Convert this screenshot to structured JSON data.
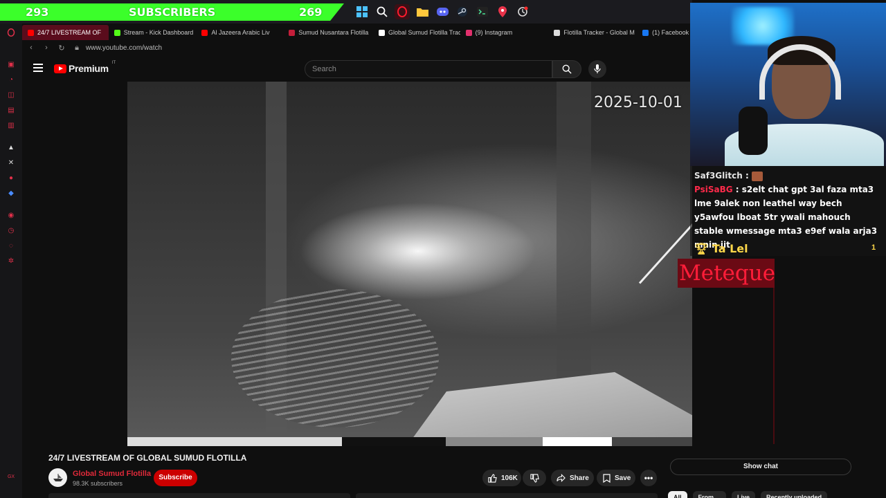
{
  "overlay": {
    "subscriber_count_left": "293",
    "subscribers_label": "SUBSCRIBERS",
    "subscriber_goal": "269",
    "accent": "#3bff2a"
  },
  "taskbar_icons": [
    "windows-icon",
    "search-icon",
    "opera-icon",
    "folder-icon",
    "discord-icon",
    "steam-icon",
    "terminal-icon",
    "maps-pin-icon",
    "updates-icon"
  ],
  "browser": {
    "tabs": [
      {
        "label": "24/7 LIVESTREAM OF",
        "color": "#ff0000"
      },
      {
        "label": "Stream - Kick Dashboard",
        "color": "#53fc18"
      },
      {
        "label": "Al Jazeera Arabic Liv",
        "color": "#ff0000"
      },
      {
        "label": "Sumud Nusantara Flotilla",
        "color": "#c41e3a"
      },
      {
        "label": "Global Sumud Flotilla Trac",
        "color": "#ffffff"
      },
      {
        "label": "(9) Instagram",
        "color": "#e1306c"
      },
      {
        "label": "Flotilla Tracker - Global M",
        "color": "#dddddd"
      },
      {
        "label": "(1) Facebook",
        "color": "#1877f2"
      }
    ],
    "url": "www.youtube.com/watch"
  },
  "youtube": {
    "logo_text": "Premium",
    "logo_region": "IT",
    "search_placeholder": "Search",
    "video_timestamp": "2025-10-01",
    "video_title": "24/7 LIVESTREAM OF GLOBAL SUMUD FLOTILLA",
    "channel_name": "Global Sumud Flotilla",
    "channel_subs": "98.3K subscribers",
    "subscribe_label": "Subscribe",
    "like_count": "106K",
    "share_label": "Share",
    "save_label": "Save",
    "show_chat_label": "Show chat",
    "chips": [
      "All",
      "From ...",
      "Live",
      "Recently uploaded"
    ]
  },
  "stream_chat": {
    "messages": [
      {
        "user": "Saf3Glitch",
        "text": ""
      },
      {
        "user": "PsiSaBG",
        "text": "s2elt chat gpt 3al faza mta3 lme 9alek non leathel way bech y5awfou lboat 5tr ywali mahouch stable wmessage mta3 e9ef wala arja3 mnin jit"
      }
    ],
    "leader_name": "Ta Lel",
    "leader_rank": "1",
    "follower_alert": "Meteque"
  }
}
